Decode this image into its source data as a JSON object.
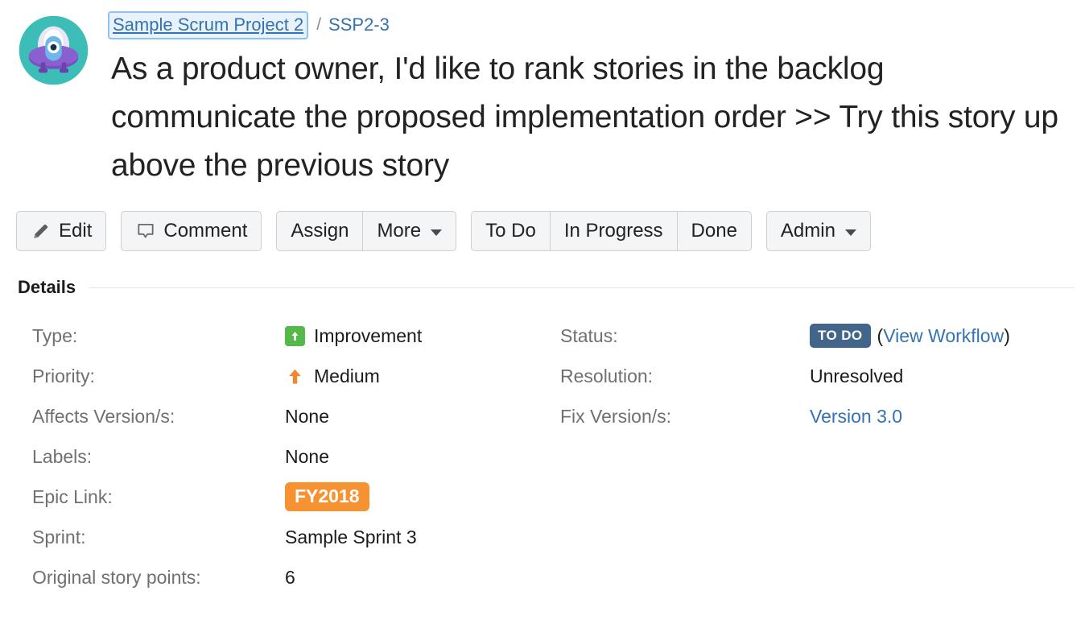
{
  "avatar": {
    "icon": "ufo-project-avatar"
  },
  "breadcrumb": {
    "project_link": "Sample Scrum Project 2",
    "separator": "/",
    "issue_key": "SSP2-3"
  },
  "issue": {
    "title": "As a product owner, I'd like to rank stories in the backlog communicate the proposed implementation order >> Try this story up above the previous story"
  },
  "toolbar": {
    "edit_label": "Edit",
    "comment_label": "Comment",
    "assign_label": "Assign",
    "more_label": "More",
    "todo_label": "To Do",
    "in_progress_label": "In Progress",
    "done_label": "Done",
    "admin_label": "Admin"
  },
  "details": {
    "section_title": "Details",
    "fields": {
      "type": {
        "label": "Type:",
        "value": "Improvement",
        "icon": "improvement-arrow-icon",
        "icon_color": "#55b949"
      },
      "priority": {
        "label": "Priority:",
        "value": "Medium",
        "icon": "priority-medium-up-arrow-icon",
        "icon_color": "#f0862e"
      },
      "affects_versions": {
        "label": "Affects Version/s:",
        "value": "None"
      },
      "labels": {
        "label": "Labels:",
        "value": "None"
      },
      "epic_link": {
        "label": "Epic Link:",
        "value": "FY2018",
        "badge_color": "#f79232"
      },
      "sprint": {
        "label": "Sprint:",
        "value": "Sample Sprint 3"
      },
      "original_story_points": {
        "label": "Original story points:",
        "value": "6"
      },
      "status": {
        "label": "Status:",
        "value": "TO DO",
        "badge_color": "#42658a",
        "workflow_open_paren": "(",
        "workflow_link": "View Workflow",
        "workflow_close_paren": ")"
      },
      "resolution": {
        "label": "Resolution:",
        "value": "Unresolved"
      },
      "fix_versions": {
        "label": "Fix Version/s:",
        "value": "Version 3.0"
      }
    }
  }
}
